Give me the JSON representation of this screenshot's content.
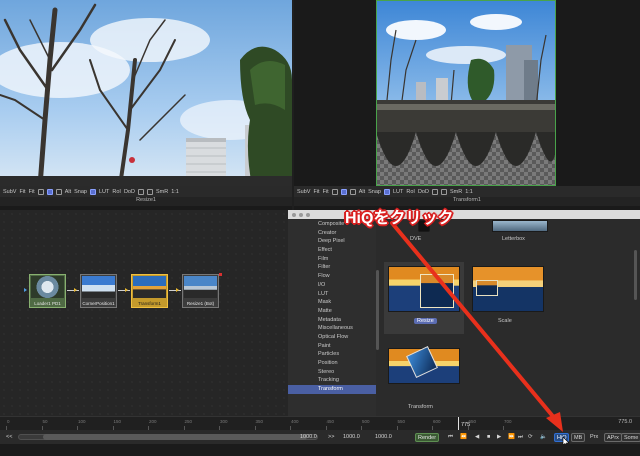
{
  "viewers": {
    "left": {
      "toolbar_items": [
        "SubV",
        "Fit",
        "Fit",
        "Alt",
        "Snap",
        "LUT",
        "RoI",
        "DoD",
        "SmR",
        "1:1"
      ],
      "caption": "Resize1"
    },
    "right": {
      "toolbar_items": [
        "SubV",
        "Fit",
        "Fit",
        "Alt",
        "Snap",
        "LUT",
        "RoI",
        "DoD",
        "SmR",
        "1:1"
      ],
      "caption": "Transform1"
    }
  },
  "flow": {
    "nodes": [
      {
        "label": "Loader1 PD1"
      },
      {
        "label": "CornerPosition1"
      },
      {
        "label": "Transform1"
      },
      {
        "label": "Resize1 (Bot)"
      }
    ]
  },
  "bins": {
    "categories": [
      "Composite",
      "Creator",
      "Deep Pixel",
      "Effect",
      "Film",
      "Filter",
      "Flow",
      "I/O",
      "LUT",
      "Mask",
      "Matte",
      "Metadata",
      "Miscellaneous",
      "Optical Flow",
      "Paint",
      "Particles",
      "Position",
      "Stereo",
      "Tracking",
      "Transform"
    ],
    "active_category": "Transform",
    "tools": [
      {
        "label": "DVE"
      },
      {
        "label": "Letterbox"
      },
      {
        "label": "Resize",
        "selected": true
      },
      {
        "label": "Scale"
      },
      {
        "label": "Transform"
      }
    ]
  },
  "timeline": {
    "ticks": [
      "0",
      "50",
      "100",
      "150",
      "200",
      "250",
      "300",
      "350",
      "400",
      "450",
      "500",
      "550",
      "600",
      "650",
      "700"
    ],
    "current_frame": "775",
    "end_frame": "775.0"
  },
  "transport": {
    "render_start": "1000.0",
    "render_end": "1000.0",
    "global_end": "1000.0",
    "range_left_label": "<<",
    "range_right_label": ">>",
    "render_label": "Render",
    "hiq_label": "HiQ",
    "mb_label": "MB",
    "prx_label": "Prx",
    "aprx_label": "APrx",
    "some_label": "Some"
  },
  "annotation": {
    "text": "HiQをクリック",
    "color": "#e8301c"
  }
}
